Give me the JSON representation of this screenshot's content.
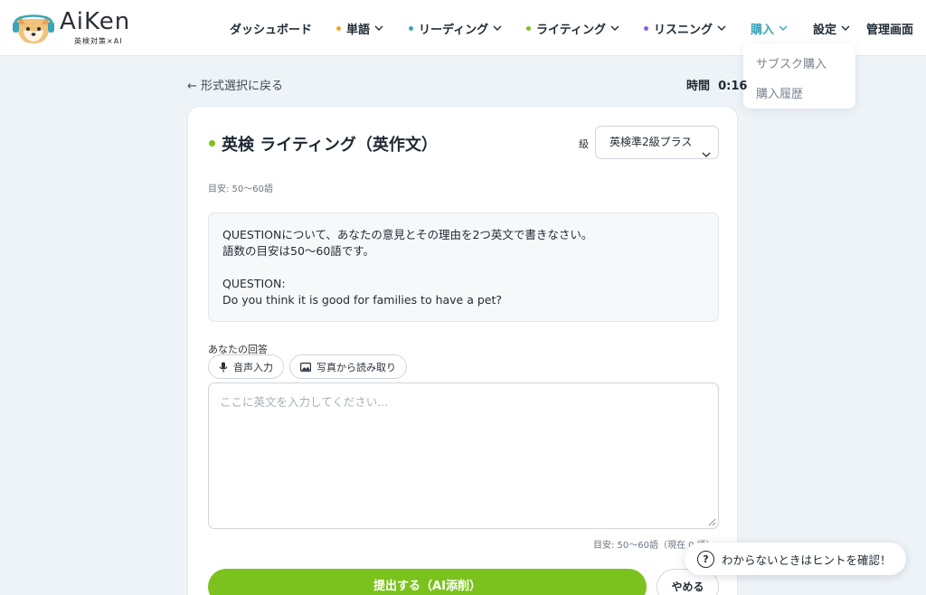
{
  "app": {
    "logo_text": "AiKen",
    "logo_subtitle": "英検対策×AI"
  },
  "nav": {
    "items": [
      {
        "label": "ダッシュボード",
        "dot": null,
        "chevron": false
      },
      {
        "label": "単語",
        "dot": "#f5a623",
        "chevron": true
      },
      {
        "label": "リーディング",
        "dot": "#3aa5b8",
        "chevron": true
      },
      {
        "label": "ライティング",
        "dot": "#7cc21e",
        "chevron": true
      },
      {
        "label": "リスニング",
        "dot": "#8b5cf6",
        "chevron": true
      },
      {
        "label": "購入",
        "dot": null,
        "chevron": true,
        "active": true
      },
      {
        "label": "設定",
        "dot": null,
        "chevron": true
      },
      {
        "label": "管理画面",
        "dot": null,
        "chevron": false
      }
    ],
    "purchase_dropdown": [
      "サブスク購入",
      "購入履歴"
    ]
  },
  "topbar": {
    "back_label": "← 形式選択に戻る",
    "timer_label": "時間",
    "timer_value": "0:16"
  },
  "card": {
    "title": "英検 ライティング（英作文）",
    "level_label": "級",
    "level_selected": "英検準2級プラス",
    "guide": "目安: 50〜60語",
    "question_lines": [
      "QUESTIONについて、あなたの意見とその理由を2つ英文で書きなさい。",
      "語数の目安は50〜60語です。",
      "",
      "QUESTION:",
      "Do you think it is good for families to have a pet?"
    ],
    "answer_label": "あなたの回答",
    "voice_input_label": "音声入力",
    "photo_input_label": "写真から読み取り",
    "textarea_placeholder": "ここに英文を入力してください...",
    "word_count": "目安: 50〜60語（現在 0 語）",
    "submit_label": "提出する（AI添削）",
    "cancel_label": "やめる"
  },
  "hint_button": {
    "label": "わからないときはヒントを確認！"
  },
  "colors": {
    "accent_green": "#7cc21e",
    "active_nav": "#3aa5b8"
  }
}
